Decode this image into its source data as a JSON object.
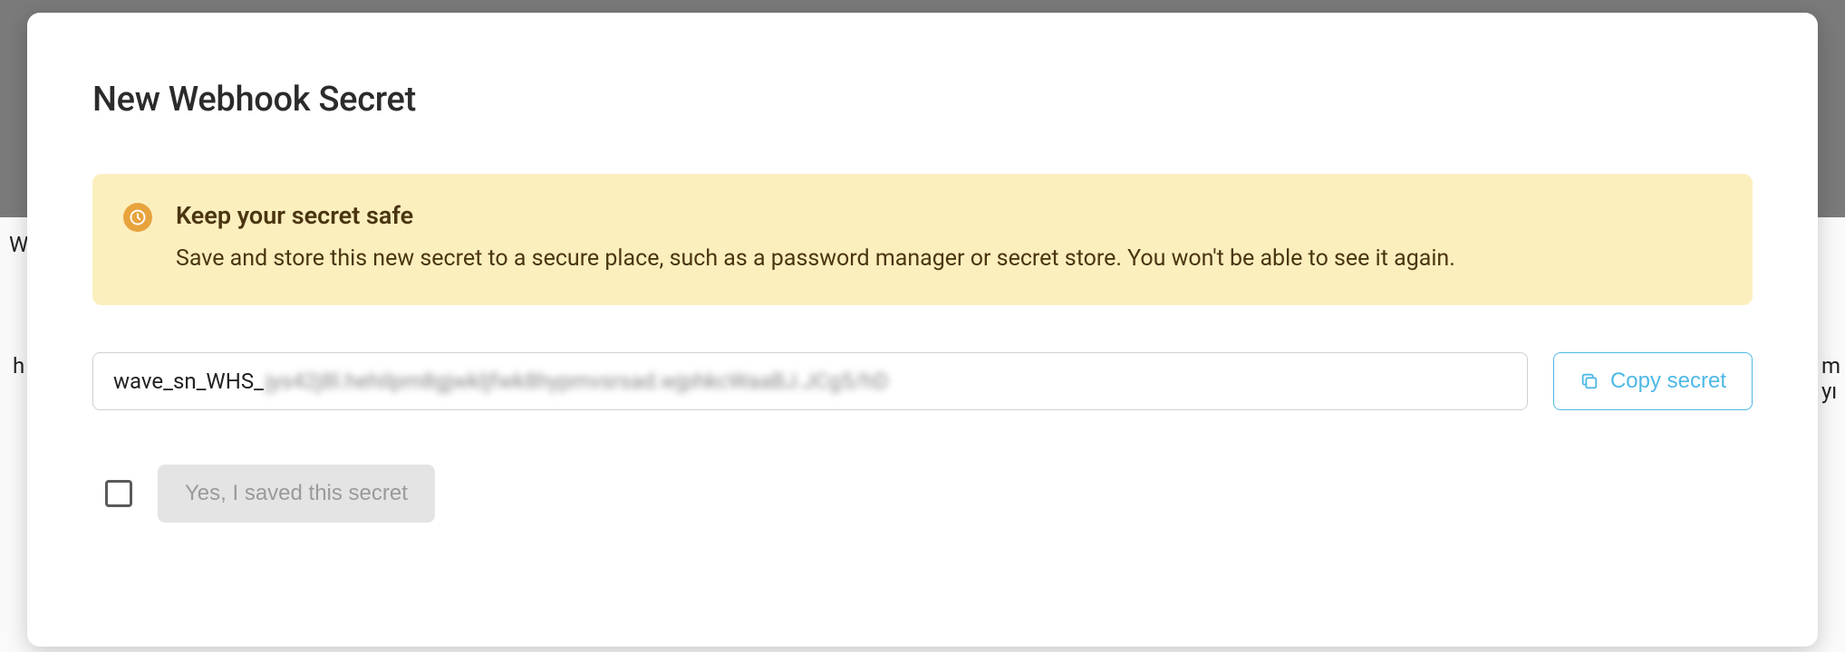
{
  "modal": {
    "title": "New Webhook Secret"
  },
  "alert": {
    "title": "Keep your secret safe",
    "text": "Save and store this new secret to a secure place, such as a password manager or secret store. You won't be able to see it again."
  },
  "secret": {
    "prefix": "wave_sn_WHS_",
    "masked": "jys42j8l.hehilpm8gjwkljfwk8hypmvsrsad.wjphkcWaaBJ.JCg5/hD"
  },
  "actions": {
    "copy_label": "Copy secret",
    "confirm_label": "Yes, I saved this secret"
  }
}
